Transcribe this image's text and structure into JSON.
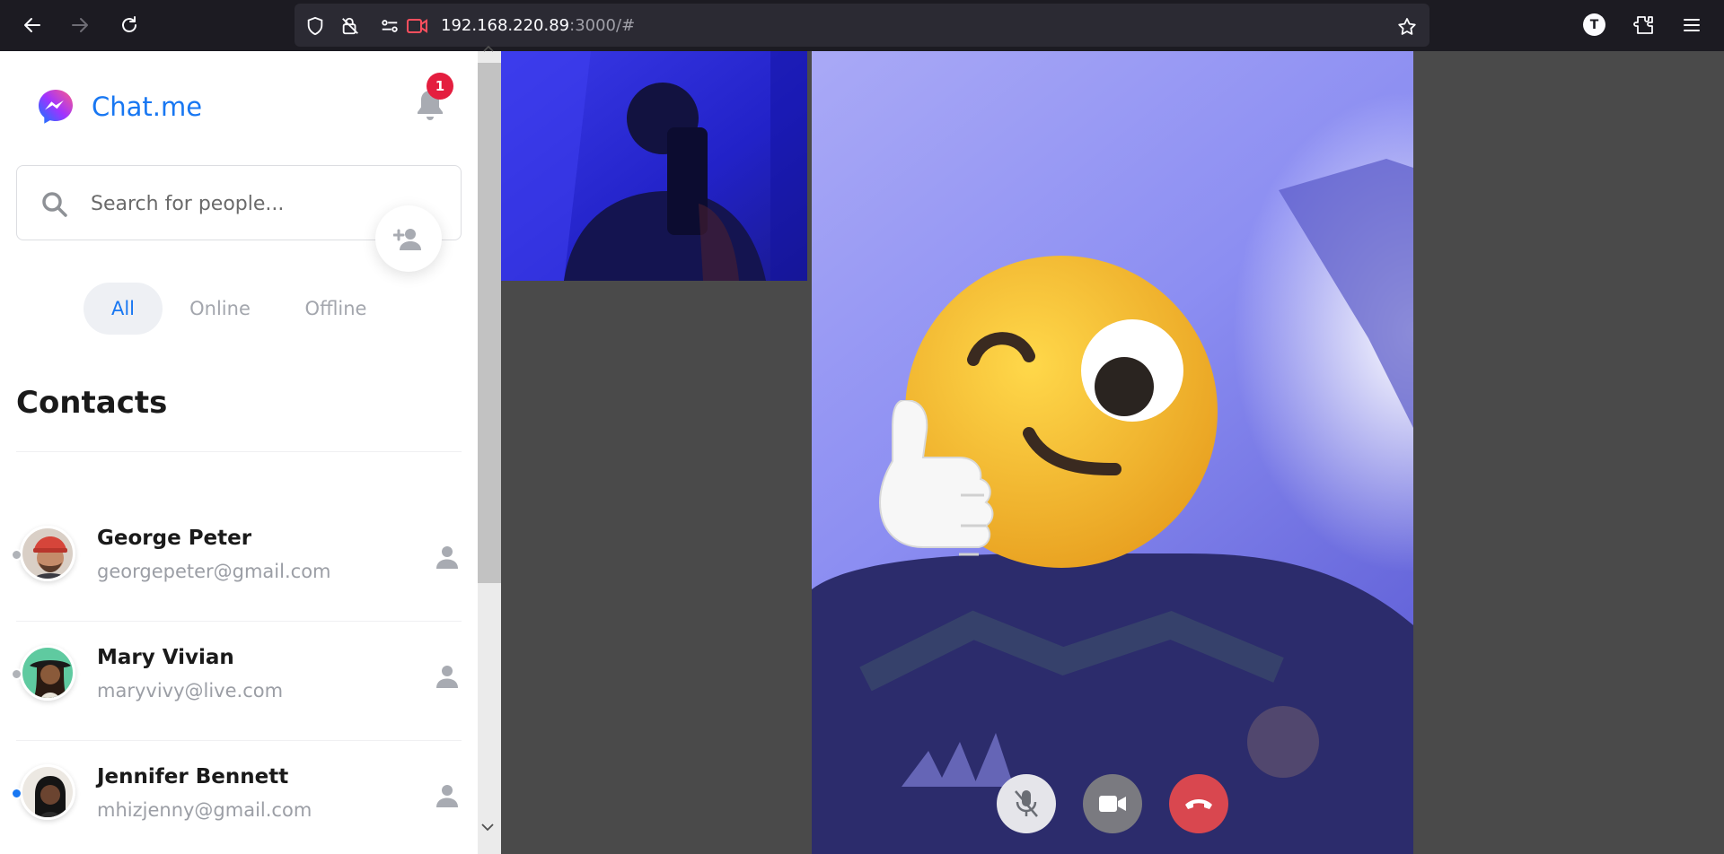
{
  "browser": {
    "url_host": "192.168.220.89",
    "url_rest": ":3000/#",
    "profile_initial": "T"
  },
  "app": {
    "brand_name": "Chat.me",
    "notification_count": "1",
    "search": {
      "placeholder": "Search for people..."
    },
    "filters": {
      "all": "All",
      "online": "Online",
      "offline": "Offline",
      "active": "All"
    },
    "contacts_title": "Contacts",
    "contacts": [
      {
        "name": "George Peter",
        "email": "georgepeter@gmail.com",
        "status_color": "#b0b3b8"
      },
      {
        "name": "Mary Vivian",
        "email": "maryvivy@live.com",
        "status_color": "#b0b3b8"
      },
      {
        "name": "Jennifer Bennett",
        "email": "mhizjenny@gmail.com",
        "status_color": "#1877f2"
      }
    ]
  },
  "call": {
    "controls": {
      "mic": "mic-off-icon",
      "camera": "video-camera-icon",
      "end": "phone-hangup-icon"
    },
    "colors": {
      "end_call": "#d9474f",
      "camera_btn": "#7a7a80",
      "mic_btn": "#e5e5ea"
    }
  },
  "colors": {
    "accent": "#1877f2",
    "badge": "#e41e3f"
  }
}
